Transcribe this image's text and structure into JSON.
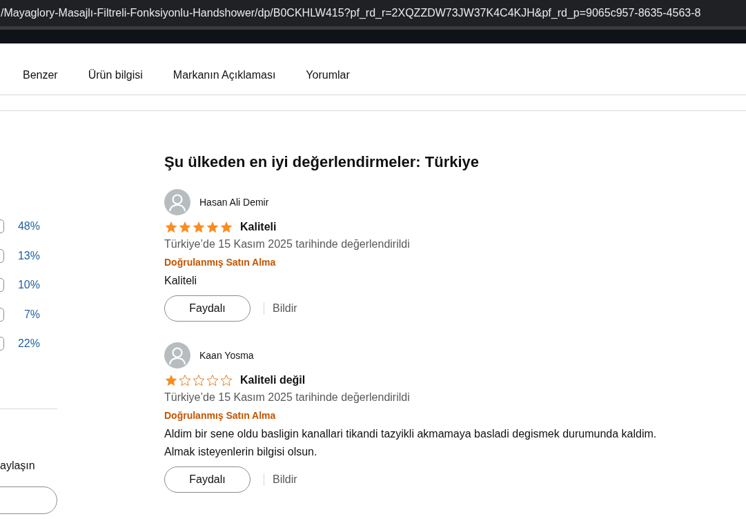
{
  "address_bar": {
    "url": "/Mayaglory-Masajlı-Filtreli-Fonksiyonlu-Handshower/dp/B0CKHLW415?pf_rd_r=2XQZZDW73JW37K4C4KJH&pf_rd_p=9065c957-8635-4563-8"
  },
  "nav_tabs": [
    {
      "label": "Benzer"
    },
    {
      "label": "Ürün bilgisi"
    },
    {
      "label": "Markanın Açıklaması"
    },
    {
      "label": "Yorumlar"
    }
  ],
  "rating_breakdown": [
    {
      "percent": "48%"
    },
    {
      "percent": "13%"
    },
    {
      "percent": "10%"
    },
    {
      "percent": "7%"
    },
    {
      "percent": "22%"
    }
  ],
  "share_section": {
    "text": "aylaşın"
  },
  "reviews_heading": "Şu ülkeden en iyi değerlendirmeler: Türkiye",
  "reviews": [
    {
      "author": "Hasan Ali Demir",
      "stars": 5,
      "title": "Kaliteli",
      "date": "Türkiye’de 15 Kasım 2025 tarihinde değerlendirildi",
      "badge": "Doğrulanmış Satın Alma",
      "body": [
        "Kaliteli"
      ],
      "helpful_button": "Faydalı",
      "report_link": "Bildir"
    },
    {
      "author": "Kaan Yosma",
      "stars": 1,
      "title": "Kaliteli değil",
      "date": "Türkiye’de 15 Kasım 2025 tarihinde değerlendirildi",
      "badge": "Doğrulanmış Satın Alma",
      "body": [
        "Aldim bir sene oldu basligin kanallari tikandi tazyikli akmamaya basladi degismek durumunda kaldim.",
        "Almak isteyenlerin bilgisi olsun."
      ],
      "helpful_button": "Faydalı",
      "report_link": "Bildir"
    }
  ]
}
